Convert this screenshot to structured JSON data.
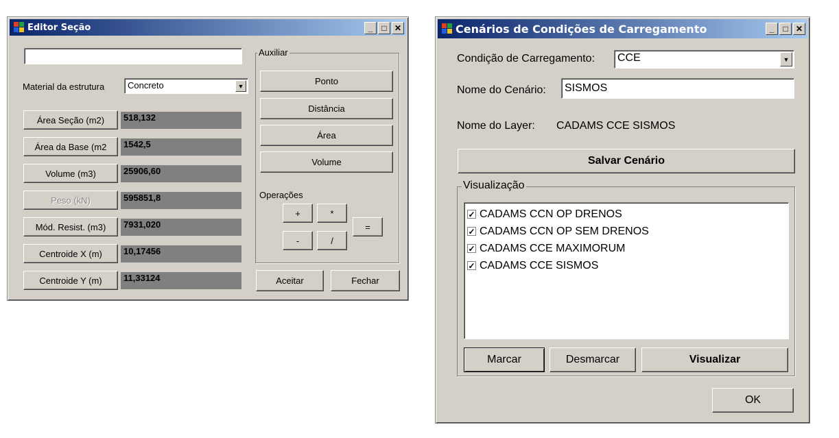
{
  "editor": {
    "title": "Editor Seção",
    "name_value": "",
    "material_label": "Material da estrutura",
    "material_value": "Concreto",
    "rows": [
      {
        "label": "Área Seção (m2)",
        "value": "518,132",
        "disabled": false
      },
      {
        "label": "Área da Base (m2",
        "value": "1542,5",
        "disabled": false
      },
      {
        "label": "Volume (m3)",
        "value": "25906,60",
        "disabled": false
      },
      {
        "label": "Peso (kN)",
        "value": "595851,8",
        "disabled": true
      },
      {
        "label": "Mód. Resist. (m3)",
        "value": "7931,020",
        "disabled": false
      },
      {
        "label": "Centroide X (m)",
        "value": "10,17456",
        "disabled": false
      },
      {
        "label": "Centroide Y (m)",
        "value": "11,33124",
        "disabled": false
      }
    ],
    "aux_group": "Auxiliar",
    "aux_buttons": [
      "Ponto",
      "Distância",
      "Área",
      "Volume"
    ],
    "ops_label": "Operações",
    "ops": {
      "plus": "+",
      "times": "*",
      "minus": "-",
      "divide": "/",
      "equals": "="
    },
    "accept": "Aceitar",
    "close": "Fechar"
  },
  "scenarios": {
    "title": "Cenários de Condições de Carregamento",
    "condition_label": "Condição de Carregamento:",
    "condition_value": "CCE",
    "scenario_name_label": "Nome do Cenário:",
    "scenario_name_value": "SISMOS",
    "layer_label": "Nome do Layer:",
    "layer_value": "CADAMS CCE SISMOS",
    "save_button": "Salvar Cenário",
    "view_group": "Visualização",
    "items": [
      {
        "label": "CADAMS CCN OP DRENOS",
        "checked": true
      },
      {
        "label": "CADAMS CCN OP SEM DRENOS",
        "checked": true
      },
      {
        "label": "CADAMS CCE MAXIMORUM",
        "checked": true
      },
      {
        "label": "CADAMS CCE SISMOS",
        "checked": true
      }
    ],
    "mark": "Marcar",
    "unmark": "Desmarcar",
    "view": "Visualizar",
    "ok": "OK"
  },
  "titlebar_buttons": {
    "minimize": "_",
    "maximize": "□",
    "close": "✕"
  },
  "colors": {
    "window_bg": "#d4d0c8",
    "title_start": "#0a246a",
    "title_end": "#a6caf0",
    "value_box": "#808080"
  }
}
